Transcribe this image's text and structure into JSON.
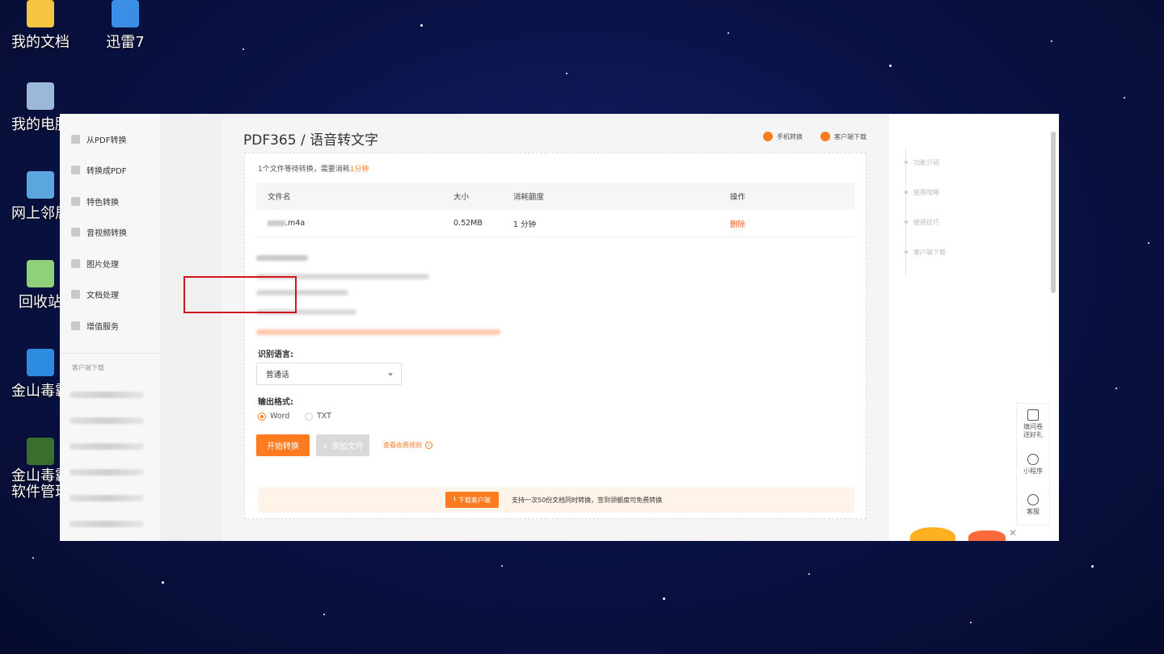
{
  "desktop": {
    "icons": [
      {
        "label": "我的文档"
      },
      {
        "label": "迅雷7"
      },
      {
        "label": "我的电脑"
      },
      {
        "label": "网上邻居"
      },
      {
        "label": "回收站"
      },
      {
        "label": "金山毒霸"
      },
      {
        "label": "金山毒霸"
      },
      {
        "label": "软件管理"
      }
    ]
  },
  "sidebar": {
    "items": [
      {
        "label": "从PDF转换"
      },
      {
        "label": "转换成PDF"
      },
      {
        "label": "特色转换"
      },
      {
        "label": "音视频转换"
      },
      {
        "label": "图片处理"
      },
      {
        "label": "文档处理"
      },
      {
        "label": "增值服务"
      }
    ],
    "client_label": "客户端下载"
  },
  "header": {
    "title": "PDF365 / 语音转文字",
    "mobile_label": "手机转换",
    "client_label": "客户端下载"
  },
  "panel": {
    "info_prefix": "1个文件等待转换，需要消耗",
    "info_highlight": "1分钟",
    "table": {
      "headers": [
        "文件名",
        "大小",
        "消耗额度",
        "操作"
      ],
      "rows": [
        {
          "name": ".m4a",
          "size": "0.52MB",
          "cost": "1 分钟",
          "action": "删除"
        }
      ]
    },
    "language_label": "识别语言:",
    "language_value": "普通话",
    "format_label": "输出格式:",
    "format_options": [
      {
        "label": "Word",
        "selected": true
      },
      {
        "label": "TXT",
        "selected": false
      }
    ],
    "start_button": "开始转换",
    "add_button": "+ 添加文件",
    "fee_link": "查看收费规则",
    "promo_button": "下载客户端",
    "promo_text": "支持一次50份文档同时转换，签到领额度可免费转换"
  },
  "right_nav": {
    "items": [
      "功能介绍",
      "使用攻略",
      "使用技巧",
      "客户端下载"
    ]
  },
  "float_bar": {
    "items": [
      {
        "line1": "填问卷",
        "line2": "送好礼"
      },
      {
        "line1": "小程序",
        "line2": ""
      },
      {
        "line1": "客服",
        "line2": ""
      }
    ]
  },
  "colors": {
    "accent": "#ff7b1f",
    "highlight_border": "#d0161b"
  }
}
